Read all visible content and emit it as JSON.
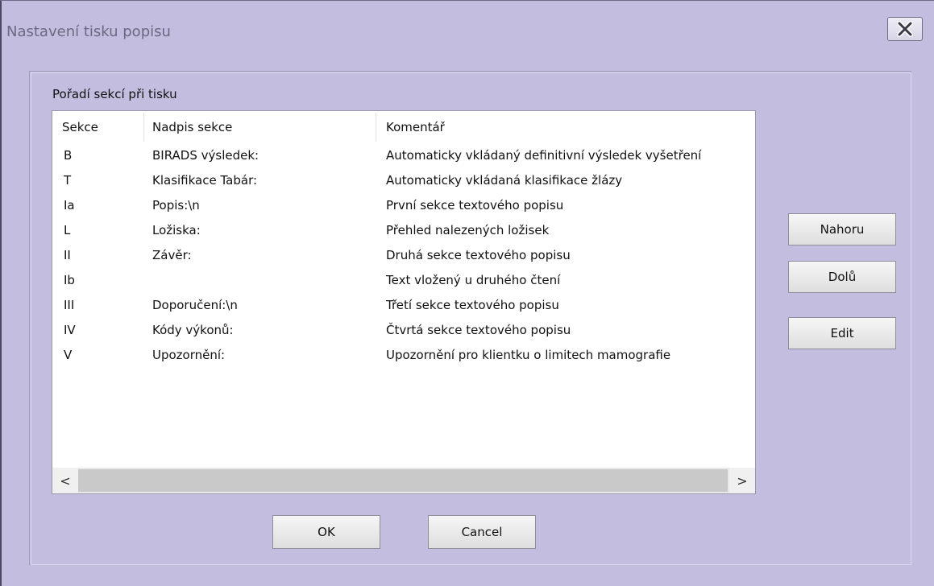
{
  "window": {
    "title": "Nastavení tisku popisu"
  },
  "group": {
    "label": "Pořadí sekcí při tisku"
  },
  "listview": {
    "columns": [
      "Sekce",
      "Nadpis sekce",
      "Komentář"
    ],
    "rows": [
      {
        "sekce": "B",
        "nadpis": "BIRADS výsledek:",
        "komentar": "Automaticky vkládaný definitivní výsledek vyšetření"
      },
      {
        "sekce": "T",
        "nadpis": "Klasifikace Tabár:",
        "komentar": "Automaticky vkládaná klasifikace žlázy"
      },
      {
        "sekce": "Ia",
        "nadpis": "Popis:\\n",
        "komentar": "První sekce textového popisu"
      },
      {
        "sekce": "L",
        "nadpis": "Ložiska:",
        "komentar": "Přehled nalezených ložisek"
      },
      {
        "sekce": "II",
        "nadpis": "Závěr:",
        "komentar": "Druhá sekce textového popisu"
      },
      {
        "sekce": "Ib",
        "nadpis": "",
        "komentar": "Text vložený u druhého čtení"
      },
      {
        "sekce": "III",
        "nadpis": "Doporučení:\\n",
        "komentar": "Třetí sekce textového popisu"
      },
      {
        "sekce": "IV",
        "nadpis": "Kódy výkonů:",
        "komentar": "Čtvrtá sekce textového popisu"
      },
      {
        "sekce": "V",
        "nadpis": "Upozornění:",
        "komentar": "Upozornění pro klientku o limitech mamografie"
      }
    ],
    "scroll_left_glyph": "<",
    "scroll_right_glyph": ">"
  },
  "buttons": {
    "up": "Nahoru",
    "down": "Dolů",
    "edit": "Edit",
    "ok": "OK",
    "cancel": "Cancel"
  },
  "icons": {
    "close": "close-icon"
  }
}
